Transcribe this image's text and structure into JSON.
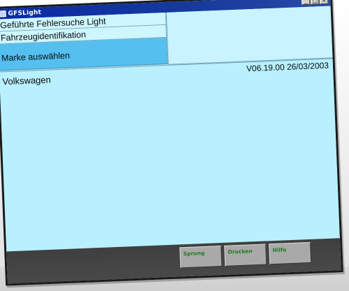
{
  "window": {
    "title": "GFSLight",
    "controls": [
      "_",
      "□",
      "×"
    ]
  },
  "menu": {
    "items": [
      {
        "label": "Geführte Fehlersuche Light"
      },
      {
        "label": "Fahrzeugidentifikation"
      },
      {
        "label": "Marke auswählen"
      }
    ]
  },
  "main": {
    "selected_brand": "Volkswagen",
    "version": "V06.19.00 26/03/2003"
  },
  "footer": {
    "buttons": [
      {
        "label": "Sprung"
      },
      {
        "label": "Drucken"
      },
      {
        "label": "Hilfe"
      }
    ]
  },
  "colors": {
    "background": "#b8f0ff",
    "active_menu": "#55bff0",
    "title_bar": "#0a2aa6",
    "button_text": "#1f7a1f"
  }
}
